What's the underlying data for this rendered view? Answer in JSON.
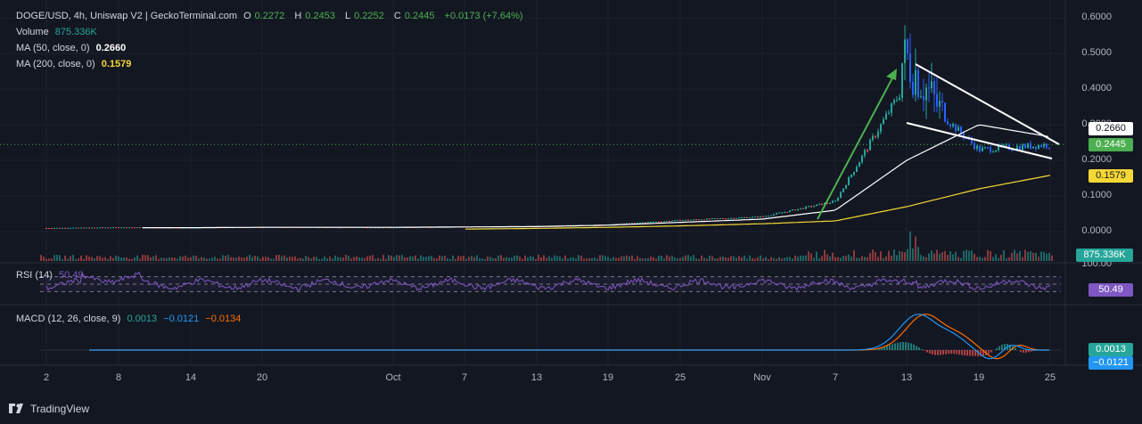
{
  "header": {
    "symbol": "DOGE/USD, 4h, Uniswap V2 | GeckoTerminal.com",
    "o_label": "O",
    "o_value": "0.2272",
    "h_label": "H",
    "h_value": "0.2453",
    "l_label": "L",
    "l_value": "0.2252",
    "c_label": "C",
    "c_value": "0.2445",
    "change": "+0.0173 (+7.64%)"
  },
  "volume": {
    "label": "Volume",
    "value": "875.336K"
  },
  "ma50": {
    "label": "MA (50, close, 0)",
    "value": "0.2660"
  },
  "ma200": {
    "label": "MA (200, close, 0)",
    "value": "0.1579"
  },
  "rsi": {
    "label": "RSI (14)",
    "value": "50.49",
    "tag": "50.49",
    "scale_top": "100.00"
  },
  "macd": {
    "label": "MACD (12, 26, close, 9)",
    "macd": "0.0013",
    "signal": "−0.0121",
    "hist": "−0.0134"
  },
  "price_tags": {
    "ma50": "0.2660",
    "close": "0.2445",
    "ma200": "0.1579",
    "volume": "875.336K",
    "macd": "0.0013",
    "signal": "−0.0121"
  },
  "footer": {
    "brand": "TradingView"
  },
  "colors": {
    "up": "#26a69a",
    "down": "#ef5350",
    "candle": "#2962ff",
    "ma50": "#ffffff",
    "ma200": "#f5d735",
    "rsi": "#7e57c2",
    "macd": "#2196f3",
    "signal": "#ff6d00",
    "arrow": "#4caf50",
    "background": "#131722"
  },
  "chart_data": {
    "type": "line",
    "title": "DOGE/USD, 4h, Uniswap V2",
    "price_axis": {
      "ticks": [
        "0.6000",
        "0.5000",
        "0.4000",
        "0.3000",
        "0.2000",
        "0.1000",
        "0.0000"
      ],
      "ylim": [
        0.0,
        0.6
      ]
    },
    "x_ticks": [
      "2",
      "8",
      "14",
      "20",
      "Oct",
      "7",
      "13",
      "19",
      "25",
      "Nov",
      "7",
      "13",
      "19",
      "25"
    ],
    "series": [
      {
        "name": "Price",
        "x": [
          "2",
          "8",
          "14",
          "20",
          "Oct",
          "7",
          "13",
          "19",
          "25",
          "Nov",
          "7",
          "13",
          "19",
          "25"
        ],
        "values": [
          0.01,
          0.012,
          0.011,
          0.013,
          0.012,
          0.014,
          0.016,
          0.02,
          0.032,
          0.042,
          0.085,
          0.42,
          0.23,
          0.2445
        ]
      },
      {
        "name": "MA (50, close, 0)",
        "x": [
          "2",
          "8",
          "14",
          "20",
          "Oct",
          "7",
          "13",
          "19",
          "25",
          "Nov",
          "7",
          "13",
          "19",
          "25"
        ],
        "values": [
          0.01,
          0.011,
          0.011,
          0.012,
          0.012,
          0.013,
          0.014,
          0.018,
          0.026,
          0.035,
          0.06,
          0.2,
          0.3,
          0.266
        ]
      },
      {
        "name": "MA (200, close, 0)",
        "x": [
          "2",
          "8",
          "14",
          "20",
          "Oct",
          "7",
          "13",
          "19",
          "25",
          "Nov",
          "7",
          "13",
          "19",
          "25"
        ],
        "values": [
          null,
          null,
          null,
          null,
          null,
          0.007,
          0.009,
          0.012,
          0.016,
          0.022,
          0.03,
          0.07,
          0.12,
          0.1579
        ]
      }
    ]
  }
}
